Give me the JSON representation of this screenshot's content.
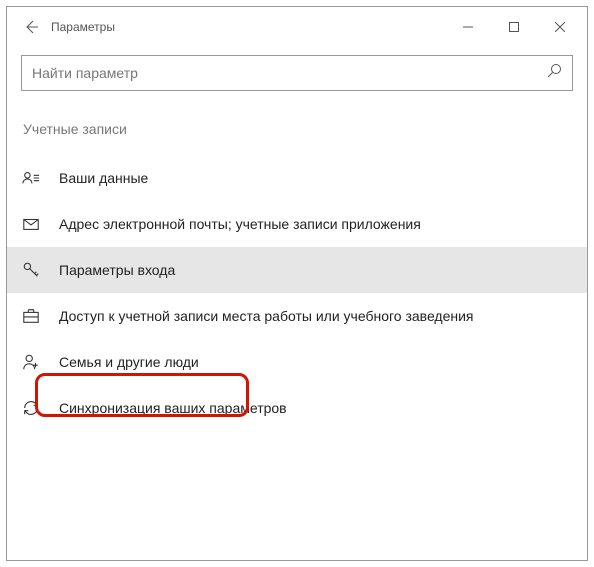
{
  "window": {
    "title": "Параметры"
  },
  "search": {
    "placeholder": "Найти параметр"
  },
  "section": {
    "header": "Учетные записи"
  },
  "nav": {
    "items": [
      {
        "label": "Ваши данные"
      },
      {
        "label": "Адрес электронной почты; учетные записи приложения"
      },
      {
        "label": "Параметры входа"
      },
      {
        "label": "Доступ к учетной записи места работы или учебного заведения"
      },
      {
        "label": "Семья и другие люди"
      },
      {
        "label": "Синхронизация ваших параметров"
      }
    ]
  }
}
